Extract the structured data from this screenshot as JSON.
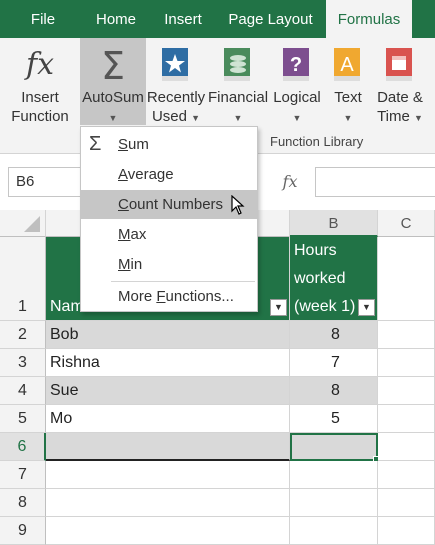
{
  "tabs": [
    "File",
    "Home",
    "Insert",
    "Page Layout",
    "Formulas"
  ],
  "ribbon": {
    "buttons": [
      {
        "line1": "Insert",
        "line2": "Function"
      },
      {
        "line1": "AutoSum",
        "line2": ""
      },
      {
        "line1": "Recently",
        "line2": "Used"
      },
      {
        "line1": "Financial",
        "line2": ""
      },
      {
        "line1": "Logical",
        "line2": ""
      },
      {
        "line1": "Text",
        "line2": ""
      },
      {
        "line1": "Date &",
        "line2": "Time"
      }
    ],
    "group_label": "Function Library",
    "fx_glyph": "fx",
    "sigma_glyph": "Σ"
  },
  "formula_bar": {
    "name_box": "B6",
    "fx": "fx"
  },
  "menu": {
    "items": [
      {
        "label": "Sum",
        "u": "S",
        "rest": "um"
      },
      {
        "label": "Average",
        "u": "A",
        "rest": "verage"
      },
      {
        "label": "Count Numbers",
        "u": "C",
        "rest": "ount Numbers"
      },
      {
        "label": "Max",
        "u": "M",
        "rest": "ax"
      },
      {
        "label": "Min",
        "u": "M",
        "rest": "in"
      },
      {
        "label": "More Functions...",
        "u": "F",
        "pre": "More ",
        "rest": "unctions..."
      }
    ],
    "sigma": "Σ"
  },
  "grid": {
    "columns": [
      "B",
      "C"
    ],
    "header_row": {
      "col_a": "Name",
      "col_b_lines": [
        "Hours",
        "worked",
        "(week 1)"
      ]
    },
    "rows": [
      {
        "num": "1"
      },
      {
        "num": "2",
        "name": "Bob",
        "hours": "8"
      },
      {
        "num": "3",
        "name": "Rishna",
        "hours": "7"
      },
      {
        "num": "4",
        "name": "Sue",
        "hours": "8"
      },
      {
        "num": "5",
        "name": "Mo",
        "hours": "5"
      },
      {
        "num": "6"
      },
      {
        "num": "7"
      },
      {
        "num": "8"
      },
      {
        "num": "9"
      }
    ]
  },
  "colors": {
    "accent": "#217346",
    "ribbon_bg": "#f3f3f3",
    "band": "#d9d9d9",
    "highlight": "#c6c6c6"
  }
}
